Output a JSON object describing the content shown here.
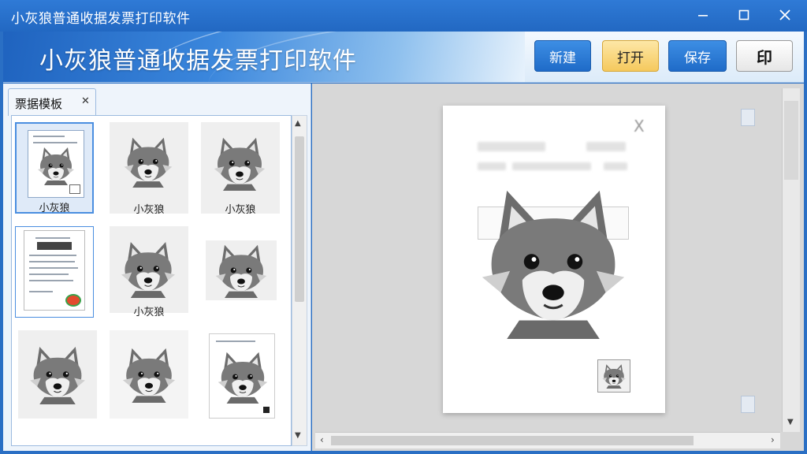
{
  "window": {
    "title": "小灰狼普通收据发票打印软件",
    "controls": {
      "minimize": "—",
      "maximize": "☐",
      "close": "✕"
    }
  },
  "header": {
    "app_title": "小灰狼普通收据发票打印软件",
    "buttons": {
      "new": "新建",
      "open": "打开",
      "save": "保存",
      "print": "印"
    }
  },
  "left_panel": {
    "tab": {
      "label": "票据模板",
      "close": "✕"
    },
    "templates": [
      {
        "caption": "小灰狼",
        "selected": true
      },
      {
        "caption": "小灰狼"
      },
      {
        "caption": "小灰狼"
      },
      {
        "caption": ""
      },
      {
        "caption": "小灰狼"
      },
      {
        "caption": ""
      },
      {
        "caption": ""
      },
      {
        "caption": ""
      },
      {
        "caption": ""
      }
    ]
  },
  "preview": {
    "close": "X",
    "arrow_left": "‹",
    "arrow_right": "›"
  },
  "colors": {
    "titlebar": "#2a6fc4",
    "button_blue": "#2a79d4",
    "button_yellow": "#f7d27a",
    "wolf_gray": "#6b6b6b"
  }
}
